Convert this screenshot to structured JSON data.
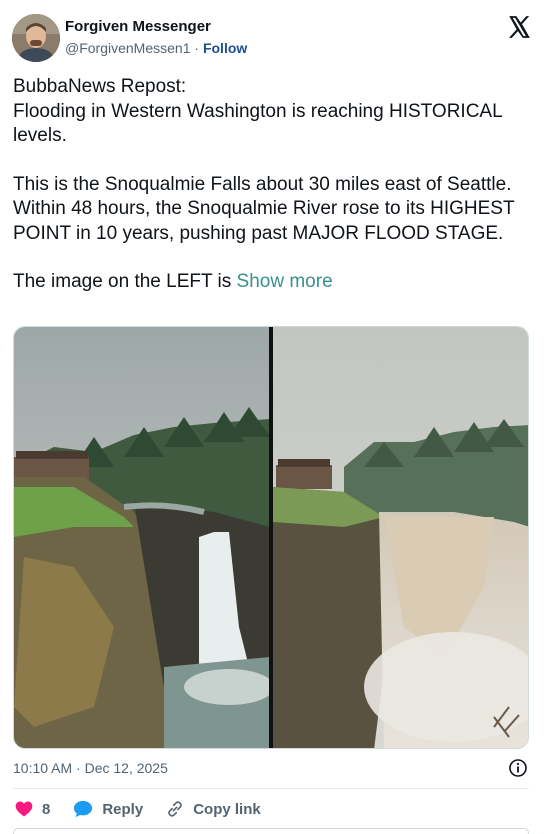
{
  "tweet": {
    "author_name": "Forgiven Messenger",
    "handle": "@ForgivenMessen1",
    "separator": "·",
    "follow_label": "Follow",
    "lines": [
      "BubbaNews Repost:",
      "Flooding in Western Washington is reaching HISTORICAL levels.",
      "This is the Snoqualmie Falls about 30 miles east of Seattle. Within 48 hours, the Snoqualmie River rose to its HIGHEST POINT in 10 years, pushing past MAJOR FLOOD STAGE.",
      "The image on the LEFT is"
    ],
    "show_more_label": "Show more",
    "timestamp": "10:10 AM · Dec 12, 2025",
    "like_count": "8",
    "reply_label": "Reply",
    "copy_link_label": "Copy link"
  },
  "icons": {
    "x_logo": "x-logo-icon",
    "info": "info-icon",
    "like": "heart-icon",
    "reply": "speech-bubble-icon",
    "copy": "link-icon"
  },
  "colors": {
    "heart": "#f91880",
    "reply": "#1d9bf0",
    "follow": "#1d4f91",
    "show_more": "#3a8f8f",
    "muted": "#536471"
  }
}
